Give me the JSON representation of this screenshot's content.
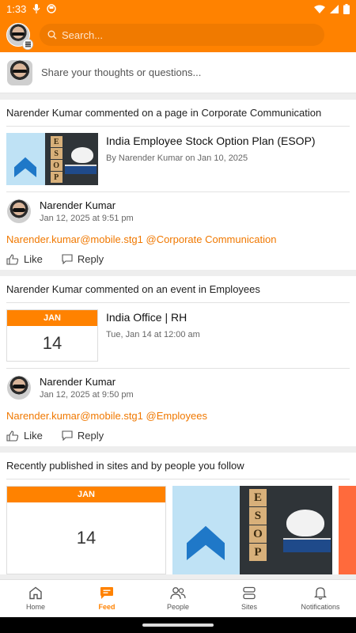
{
  "status_bar": {
    "time": "1:33"
  },
  "search": {
    "placeholder": "Search..."
  },
  "composer": {
    "prompt": "Share your thoughts or questions..."
  },
  "feed": [
    {
      "actor": "Narender Kumar",
      "verb": "commented on a page in",
      "target": "Corporate Communication",
      "attachment": {
        "title": "India Employee Stock Option Plan (ESOP)",
        "meta": "By Narender Kumar on Jan 10, 2025"
      },
      "comment": {
        "author": "Narender Kumar",
        "time": "Jan 12, 2025 at 9:51 pm",
        "body": "Narender.kumar@mobile.stg1 @Corporate Communication"
      }
    },
    {
      "actor": "Narender Kumar",
      "verb": "commented on an event in",
      "target": "Employees",
      "event": {
        "month": "JAN",
        "day": "14",
        "title": "India Office | RH",
        "meta": "Tue, Jan 14 at 12:00 am"
      },
      "comment": {
        "author": "Narender Kumar",
        "time": "Jan 12, 2025 at 9:50 pm",
        "body": "Narender.kumar@mobile.stg1 @Employees"
      }
    }
  ],
  "actions": {
    "like": "Like",
    "reply": "Reply"
  },
  "recent": {
    "heading": "Recently published in sites and by people you follow",
    "cal_month": "JAN",
    "cal_day": "14"
  },
  "esop_blocks": [
    "E",
    "S",
    "O",
    "P"
  ],
  "nav": {
    "home": "Home",
    "feed": "Feed",
    "people": "People",
    "sites": "Sites",
    "notifications": "Notifications"
  },
  "colors": {
    "brand": "#ff8200",
    "link": "#f07800"
  }
}
